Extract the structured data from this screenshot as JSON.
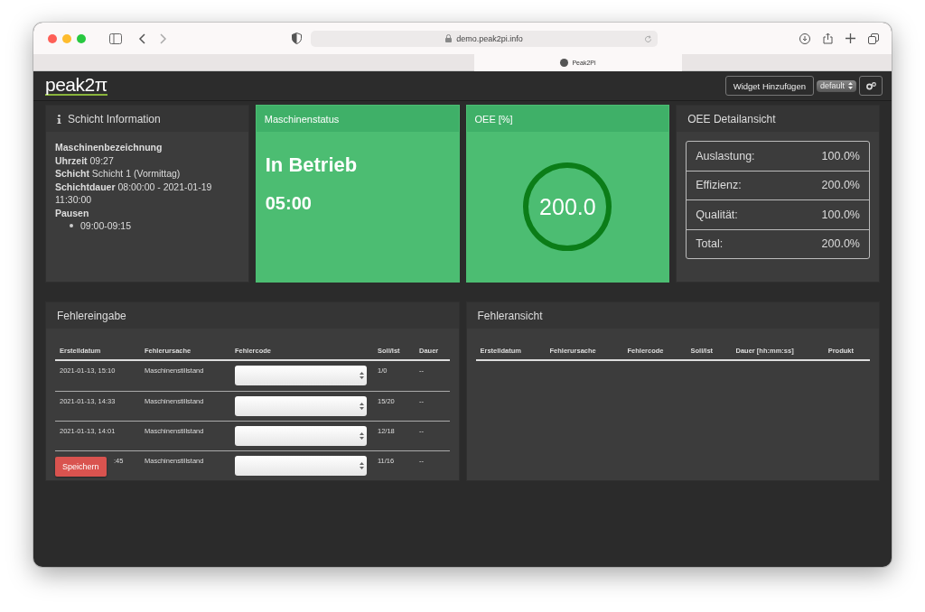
{
  "browser": {
    "url": "demo.peak2pi.info",
    "tab_title": "Peak2Pi"
  },
  "header": {
    "logo": "peak2π",
    "add_widget_button": "Widget Hinzufügen",
    "layout_select": "default"
  },
  "schicht_info": {
    "title": "Schicht Information",
    "lines": [
      {
        "label": "Maschinenbezeichnung"
      },
      {
        "label": "Uhrzeit",
        "value": "09:27"
      },
      {
        "label": "Schicht",
        "value": "Schicht 1 (Vormittag)"
      },
      {
        "label": "Schichtdauer",
        "value": "08:00:00 - 2021-01-19 11:30:00"
      }
    ],
    "pausen_label": "Pausen",
    "pausen": [
      "09:00-09:15"
    ]
  },
  "maschinenstatus": {
    "title": "Maschinenstatus",
    "status": "In Betrieb",
    "time": "05:00"
  },
  "oee": {
    "title": "OEE [%]",
    "value": "200.0"
  },
  "oee_detail": {
    "title": "OEE Detailansicht",
    "rows": [
      {
        "label": "Auslastung:",
        "value": "100.0%"
      },
      {
        "label": "Effizienz:",
        "value": "200.0%"
      },
      {
        "label": "Qualität:",
        "value": "100.0%"
      },
      {
        "label": "Total:",
        "value": "200.0%"
      }
    ]
  },
  "fehlereingabe": {
    "title": "Fehlereingabe",
    "columns": [
      "Erstelldatum",
      "Fehlerursache",
      "Fehlercode",
      "Soll/Ist",
      "Dauer"
    ],
    "rows": [
      {
        "date": "2021-01-13, 15:10",
        "cause": "Maschinenstillstand",
        "soll_ist": "1/0",
        "dauer": "--"
      },
      {
        "date": "2021-01-13, 14:33",
        "cause": "Maschinenstillstand",
        "soll_ist": "15/20",
        "dauer": "--"
      },
      {
        "date": "2021-01-13, 14:01",
        "cause": "Maschinenstillstand",
        "soll_ist": "12/18",
        "dauer": "--"
      },
      {
        "date": ":45",
        "cause": "Maschinenstillstand",
        "soll_ist": "11/16",
        "dauer": "--"
      }
    ],
    "save_button": "Speichern"
  },
  "fehleransicht": {
    "title": "Fehleransicht",
    "columns": [
      "Erstelldatum",
      "Fehlerursache",
      "Fehlercode",
      "Soll/Ist",
      "Dauer [hh:mm:ss]",
      "Produkt"
    ]
  }
}
